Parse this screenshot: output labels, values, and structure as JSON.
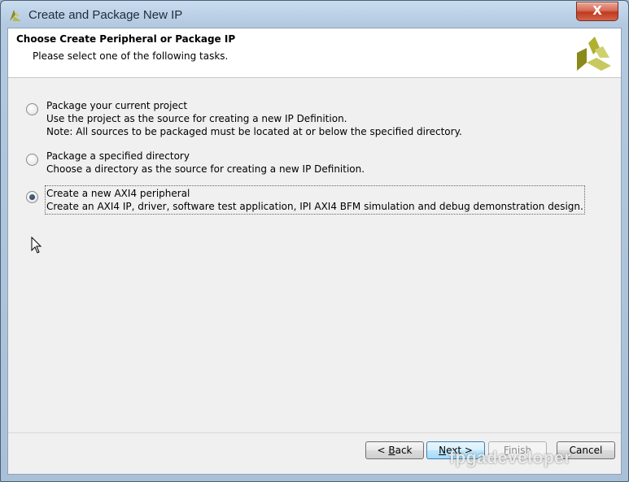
{
  "window": {
    "title": "Create and Package New IP",
    "close_label": "X"
  },
  "header": {
    "title": "Choose Create Peripheral or Package IP",
    "subtitle": "Please select one of the following tasks."
  },
  "options": [
    {
      "title": "Package your current project",
      "lines": [
        "Use the project as the source for creating a new IP Definition.",
        "Note: All sources to be packaged must be located at or below the specified directory."
      ],
      "selected": false
    },
    {
      "title": "Package a specified directory",
      "lines": [
        "Choose a directory as the source for creating a new IP Definition."
      ],
      "selected": false
    },
    {
      "title": "Create a new AXI4 peripheral",
      "lines": [
        "Create  an AXI4 IP, driver, software test application, IPI AXI4 BFM simulation and debug demonstration design."
      ],
      "selected": true
    }
  ],
  "buttons": {
    "back": {
      "prefix": "< ",
      "mnemonic": "B",
      "rest": "ack"
    },
    "next": {
      "prefix": "",
      "mnemonic": "N",
      "rest": "ext >"
    },
    "finish": {
      "prefix": "",
      "mnemonic": "F",
      "rest": "inish"
    },
    "cancel": {
      "label": "Cancel"
    }
  },
  "watermark": "fpgadeveloper",
  "colors": {
    "logo_dark": "#8a8a1a",
    "logo_light": "#c8c860",
    "title_bar": "#b3c9e0"
  }
}
